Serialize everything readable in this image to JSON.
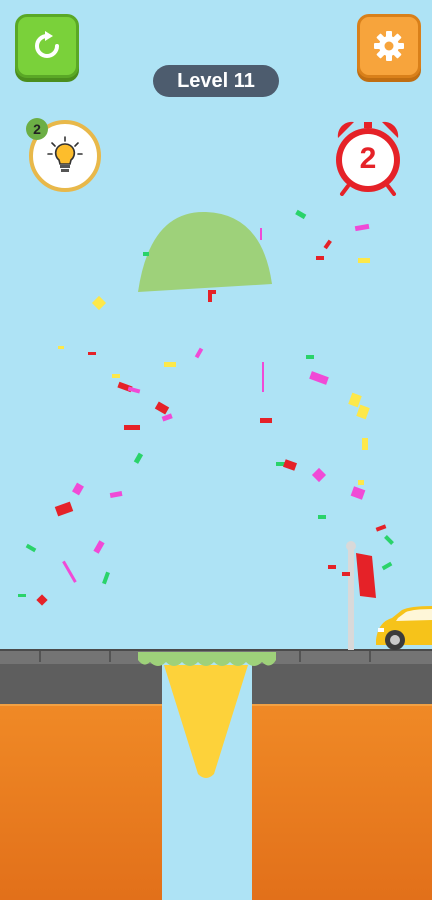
{
  "hud": {
    "level_label": "Level 11",
    "hint_count": "2",
    "timer_value": "2"
  },
  "icons": {
    "restart": "restart-icon",
    "settings": "gear-icon",
    "hint": "lightbulb-icon",
    "timer": "alarm-clock-icon"
  },
  "colors": {
    "sky": "#aee3f5",
    "ice_cream": "#9ed17a",
    "cone": "#fdd23a",
    "ground": "#ec7d1c",
    "road": "#5d5d5d",
    "car": "#f6c31a",
    "restart_button": "#7ad13a",
    "settings_button": "#f7a43c",
    "timer_red": "#e52228"
  }
}
